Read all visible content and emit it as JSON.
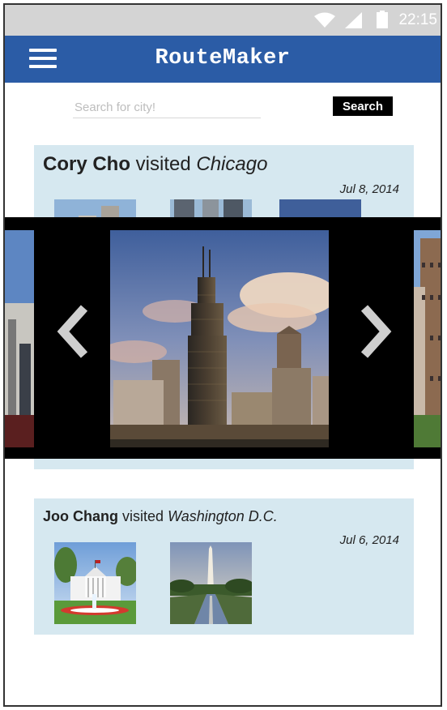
{
  "status_bar": {
    "time": "22:15"
  },
  "app_bar": {
    "title": "RouteMaker",
    "menu_icon": "hamburger-menu-icon"
  },
  "search": {
    "placeholder": "Search for city!",
    "value": "",
    "button_label": "Search"
  },
  "posts": [
    {
      "user": "Cory Cho",
      "verb": "visited",
      "city": "Chicago",
      "date": "Jul 8, 2014",
      "photos": [
        "chicago-photo-1",
        "chicago-photo-2",
        "chicago-photo-3"
      ]
    },
    {
      "user": "Joo Chang",
      "verb": "visited",
      "city": "Washington D.C.",
      "date": "Jul 6, 2014",
      "photos": [
        "white-house-photo",
        "washington-monument-photo"
      ]
    }
  ],
  "lightbox": {
    "current_photo": "willis-tower-photo",
    "prev_icon": "chevron-left-icon",
    "next_icon": "chevron-right-icon"
  },
  "colors": {
    "app_bar": "#2b5ca6",
    "card_background": "#d6e8f0",
    "status_bar": "#d4d4d4",
    "search_button": "#000000"
  }
}
